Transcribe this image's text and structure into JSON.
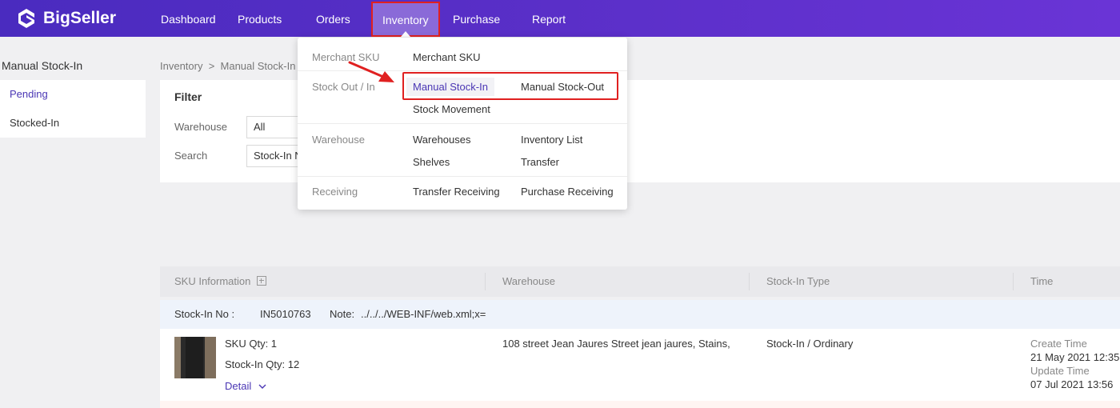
{
  "app": {
    "brand": "BigSeller"
  },
  "nav": {
    "dashboard": "Dashboard",
    "products": "Products",
    "orders": "Orders",
    "inventory": "Inventory",
    "purchase": "Purchase",
    "report": "Report"
  },
  "sidebar": {
    "title": "Manual Stock-In",
    "items": [
      {
        "label": "Pending",
        "active": true
      },
      {
        "label": "Stocked-In",
        "active": false
      }
    ]
  },
  "breadcrumb": "Inventory  >  Manual Stock-In  >",
  "filter": {
    "title": "Filter",
    "warehouse_label": "Warehouse",
    "warehouse_value": "All",
    "search_label": "Search",
    "search_value": "Stock-In No"
  },
  "table": {
    "headers": [
      "SKU Information",
      "Warehouse",
      "Stock-In Type",
      "Time"
    ],
    "order": {
      "stock_in_no_label": "Stock-In No :",
      "stock_in_no": "IN5010763",
      "note_label": "Note:",
      "note": "../../../WEB-INF/web.xml;x="
    },
    "row": {
      "sku_qty": "SKU Qty: 1",
      "stock_in_qty": "Stock-In Qty: 12",
      "detail": "Detail",
      "warehouse": "108 street Jean Jaures Street jean jaures, Stains,",
      "type": "Stock-In / Ordinary",
      "create_label": "Create Time",
      "create_time": "21 May 2021 12:35",
      "update_label": "Update Time",
      "update_time": "07 Jul 2021 13:56"
    }
  },
  "dropdown": {
    "groups": [
      {
        "label": "Merchant SKU",
        "links": [
          "Merchant SKU"
        ]
      },
      {
        "label": "Stock Out / In",
        "links": [
          "Manual Stock-In",
          "Manual Stock-Out",
          "Stock Movement"
        ]
      },
      {
        "label": "Warehouse",
        "links": [
          "Warehouses",
          "Inventory List",
          "Shelves",
          "Transfer"
        ]
      },
      {
        "label": "Receiving",
        "links": [
          "Transfer Receiving",
          "Purchase Receiving"
        ]
      }
    ]
  },
  "colors": {
    "brand": "#5a2fc8",
    "accent": "#4a36b4",
    "highlight": "#e02020"
  }
}
